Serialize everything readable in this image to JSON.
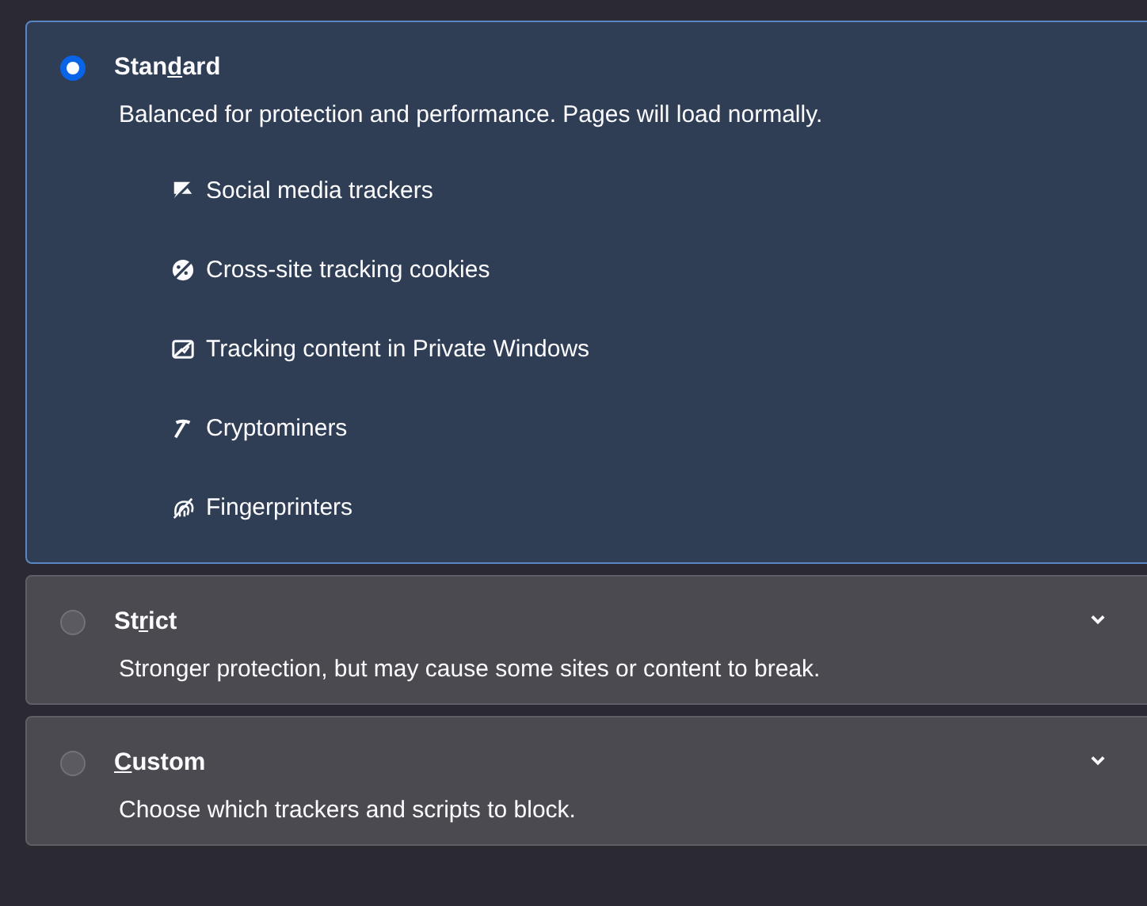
{
  "options": [
    {
      "label_parts": [
        {
          "text": "Stan",
          "underline": false
        },
        {
          "text": "d",
          "underline": true
        },
        {
          "text": "ard",
          "underline": false
        }
      ],
      "selected": true,
      "description": "Balanced for protection and performance. Pages will load normally.",
      "items": [
        {
          "kind": "social",
          "label": "Social media trackers"
        },
        {
          "kind": "cookies",
          "label": "Cross-site tracking cookies"
        },
        {
          "kind": "content",
          "label": "Tracking content in Private Windows"
        },
        {
          "kind": "cryptominers",
          "label": "Cryptominers"
        },
        {
          "kind": "fingerprinters",
          "label": "Fingerprinters"
        }
      ]
    },
    {
      "label_parts": [
        {
          "text": "St",
          "underline": false
        },
        {
          "text": "r",
          "underline": true
        },
        {
          "text": "ict",
          "underline": false
        }
      ],
      "selected": false,
      "description": "Stronger protection, but may cause some sites or content to break."
    },
    {
      "label_parts": [
        {
          "text": "C",
          "underline": true
        },
        {
          "text": "ustom",
          "underline": false
        }
      ],
      "selected": false,
      "description": "Choose which trackers and scripts to block."
    }
  ]
}
